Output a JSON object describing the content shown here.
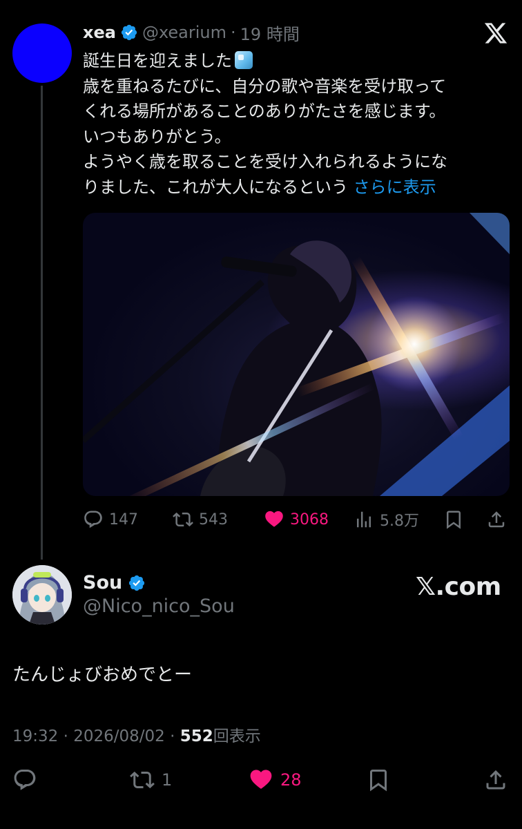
{
  "parent_tweet": {
    "name": "xea",
    "handle": "@xearium",
    "separator": "·",
    "time": "19 時間",
    "lines": [
      "誕生日を迎えました",
      "歳を重ねるたびに、自分の歌や音楽を受け取って",
      "くれる場所があることのありがたさを感じます。",
      "いつもありがとう。",
      "ようやく歳を取ることを受け入れられるようにな",
      "りました、これが大人になるという "
    ],
    "show_more": "さらに表示",
    "stats": {
      "replies": "147",
      "reposts": "543",
      "likes": "3068",
      "views": "5.8万"
    },
    "avatar_color": "#0b00ff"
  },
  "reply_tweet": {
    "name": "Sou",
    "handle": "@Nico_nico_Sou",
    "text": "たんじょびおめでとー",
    "time": "19:32",
    "date": "2026/08/02",
    "separator": "·",
    "views": "552",
    "views_label": "回表示",
    "stats": {
      "reposts": "1",
      "likes": "28"
    }
  },
  "watermark": "𝕏.com",
  "colors": {
    "accent": "#1d9bf0",
    "like": "#f91880",
    "muted": "#71767b"
  }
}
